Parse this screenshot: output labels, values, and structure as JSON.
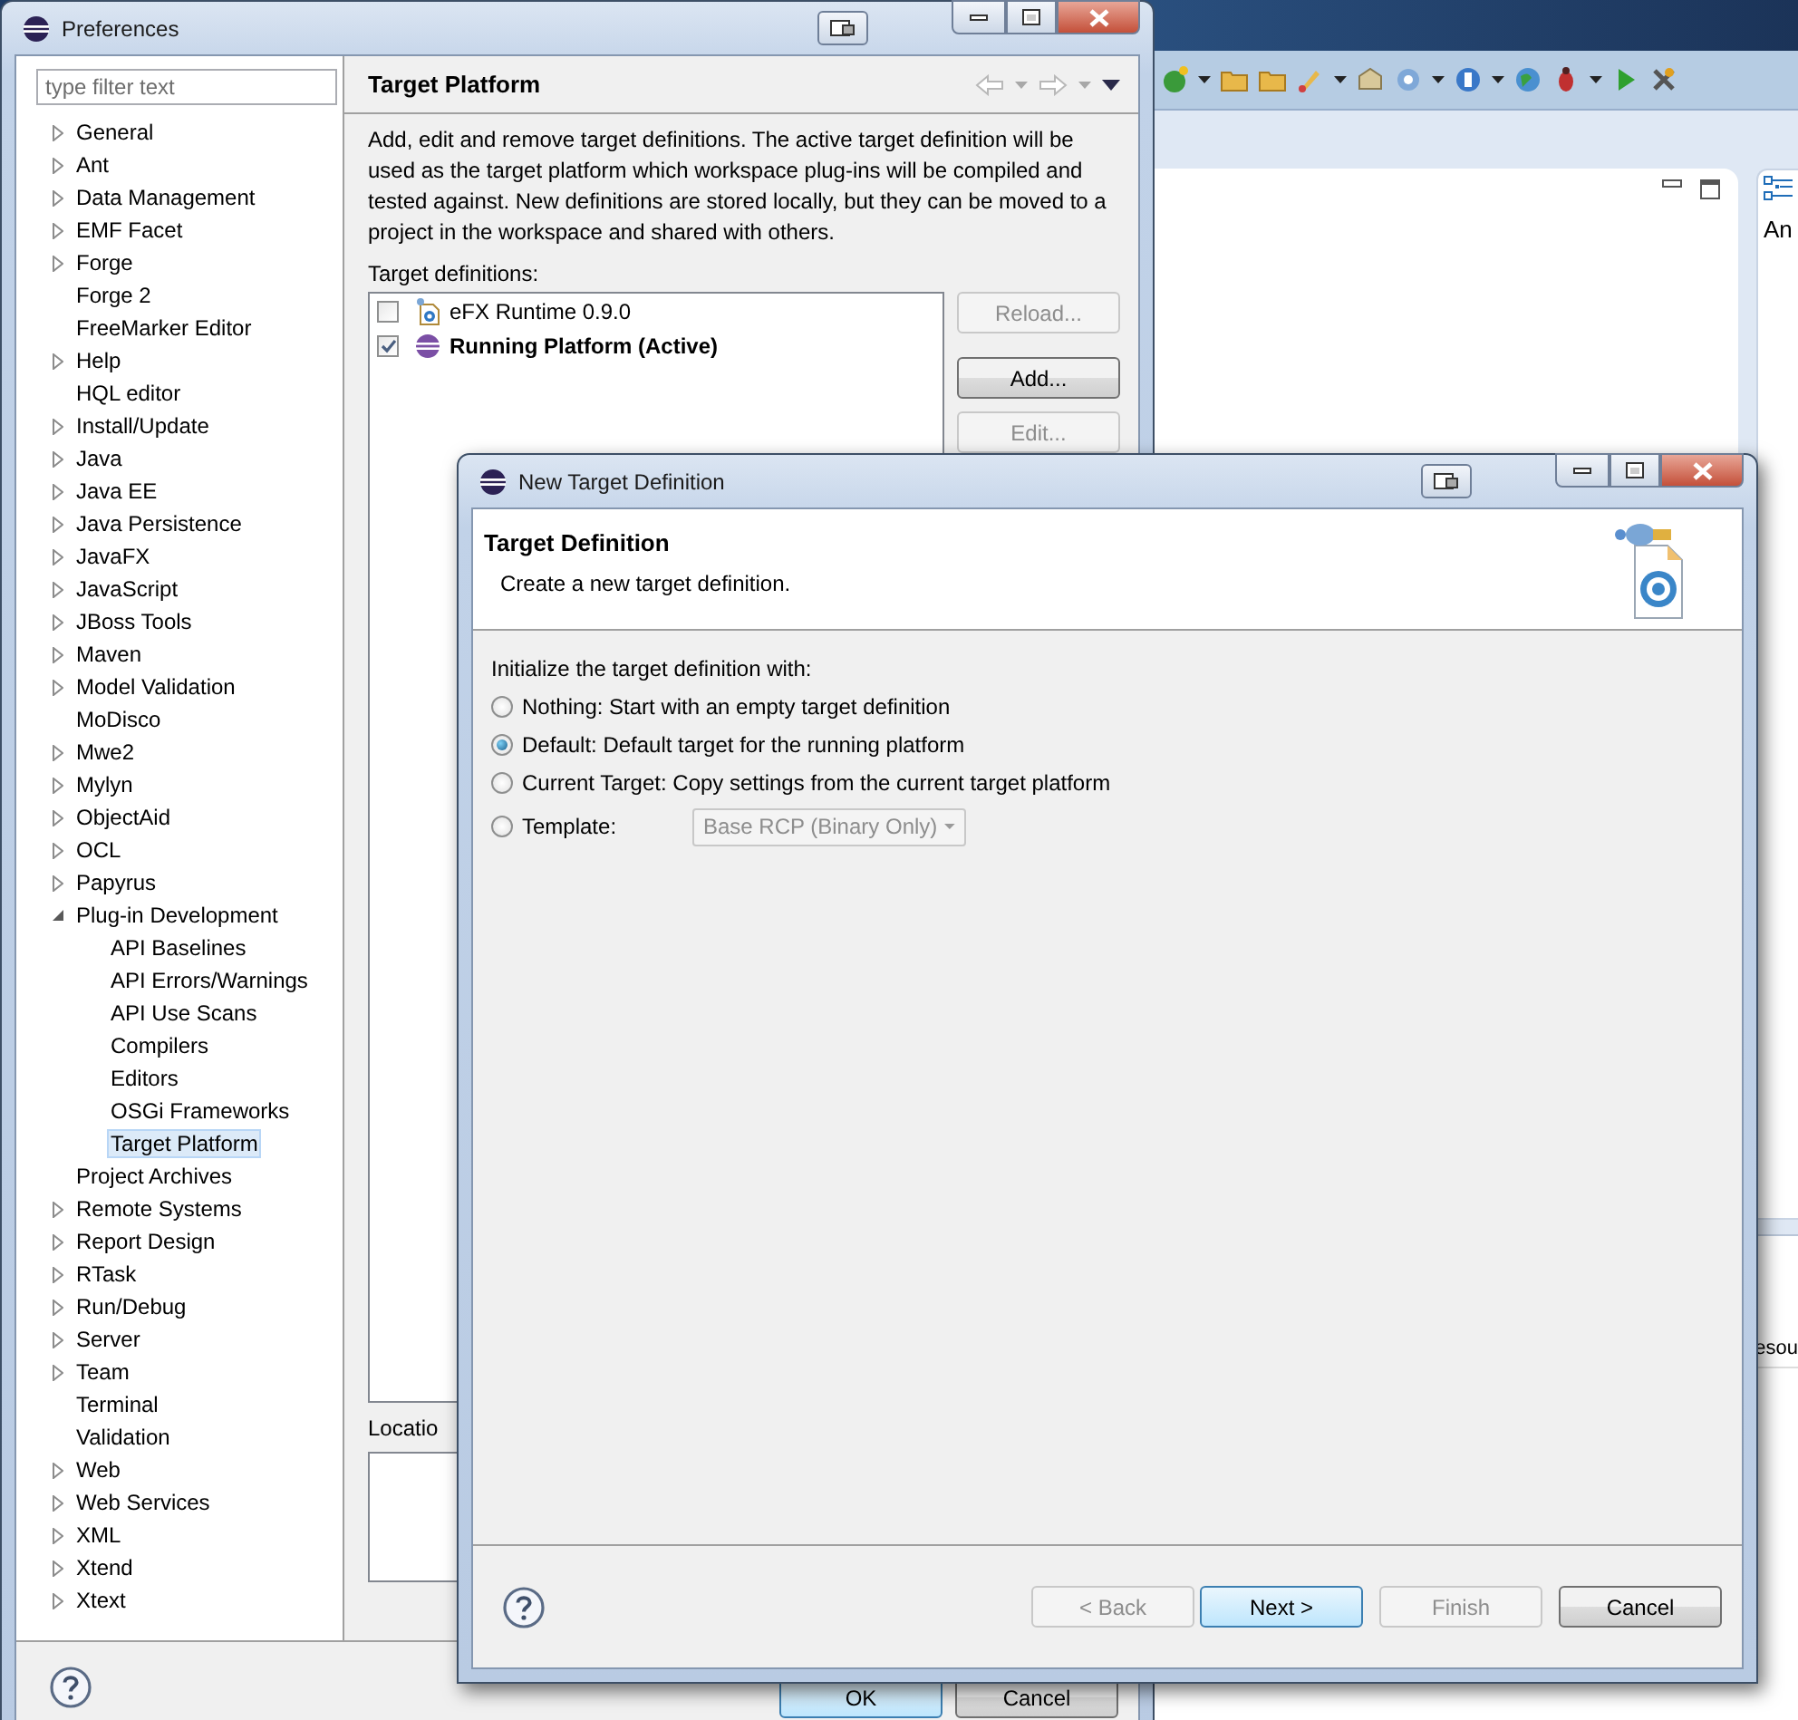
{
  "workbench": {
    "side_view_text": "An",
    "table_header_text": "esou"
  },
  "preferences": {
    "title": "Preferences",
    "filter": {
      "placeholder": "type filter text"
    },
    "tree": [
      {
        "label": "General",
        "expandable": true,
        "expanded": false,
        "selected": false
      },
      {
        "label": "Ant",
        "expandable": true,
        "expanded": false,
        "selected": false
      },
      {
        "label": "Data Management",
        "expandable": true,
        "expanded": false,
        "selected": false
      },
      {
        "label": "EMF Facet",
        "expandable": true,
        "expanded": false,
        "selected": false
      },
      {
        "label": "Forge",
        "expandable": true,
        "expanded": false,
        "selected": false
      },
      {
        "label": "Forge 2",
        "expandable": false,
        "selected": false
      },
      {
        "label": "FreeMarker Editor",
        "expandable": false,
        "selected": false
      },
      {
        "label": "Help",
        "expandable": true,
        "expanded": false,
        "selected": false
      },
      {
        "label": "HQL editor",
        "expandable": false,
        "selected": false
      },
      {
        "label": "Install/Update",
        "expandable": true,
        "expanded": false,
        "selected": false
      },
      {
        "label": "Java",
        "expandable": true,
        "expanded": false,
        "selected": false
      },
      {
        "label": "Java EE",
        "expandable": true,
        "expanded": false,
        "selected": false
      },
      {
        "label": "Java Persistence",
        "expandable": true,
        "expanded": false,
        "selected": false
      },
      {
        "label": "JavaFX",
        "expandable": true,
        "expanded": false,
        "selected": false
      },
      {
        "label": "JavaScript",
        "expandable": true,
        "expanded": false,
        "selected": false
      },
      {
        "label": "JBoss Tools",
        "expandable": true,
        "expanded": false,
        "selected": false
      },
      {
        "label": "Maven",
        "expandable": true,
        "expanded": false,
        "selected": false
      },
      {
        "label": "Model Validation",
        "expandable": true,
        "expanded": false,
        "selected": false
      },
      {
        "label": "MoDisco",
        "expandable": false,
        "selected": false
      },
      {
        "label": "Mwe2",
        "expandable": true,
        "expanded": false,
        "selected": false
      },
      {
        "label": "Mylyn",
        "expandable": true,
        "expanded": false,
        "selected": false
      },
      {
        "label": "ObjectAid",
        "expandable": true,
        "expanded": false,
        "selected": false
      },
      {
        "label": "OCL",
        "expandable": true,
        "expanded": false,
        "selected": false
      },
      {
        "label": "Papyrus",
        "expandable": true,
        "expanded": false,
        "selected": false
      },
      {
        "label": "Plug-in Development",
        "expandable": true,
        "expanded": true,
        "selected": false,
        "children": [
          {
            "label": "API Baselines",
            "selected": false
          },
          {
            "label": "API Errors/Warnings",
            "selected": false
          },
          {
            "label": "API Use Scans",
            "selected": false
          },
          {
            "label": "Compilers",
            "selected": false
          },
          {
            "label": "Editors",
            "selected": false
          },
          {
            "label": "OSGi Frameworks",
            "selected": false
          },
          {
            "label": "Target Platform",
            "selected": true
          }
        ]
      },
      {
        "label": "Project Archives",
        "expandable": false,
        "selected": false
      },
      {
        "label": "Remote Systems",
        "expandable": true,
        "expanded": false,
        "selected": false
      },
      {
        "label": "Report Design",
        "expandable": true,
        "expanded": false,
        "selected": false
      },
      {
        "label": "RTask",
        "expandable": true,
        "expanded": false,
        "selected": false
      },
      {
        "label": "Run/Debug",
        "expandable": true,
        "expanded": false,
        "selected": false
      },
      {
        "label": "Server",
        "expandable": true,
        "expanded": false,
        "selected": false
      },
      {
        "label": "Team",
        "expandable": true,
        "expanded": false,
        "selected": false
      },
      {
        "label": "Terminal",
        "expandable": false,
        "selected": false
      },
      {
        "label": "Validation",
        "expandable": false,
        "selected": false
      },
      {
        "label": "Web",
        "expandable": true,
        "expanded": false,
        "selected": false
      },
      {
        "label": "Web Services",
        "expandable": true,
        "expanded": false,
        "selected": false
      },
      {
        "label": "XML",
        "expandable": true,
        "expanded": false,
        "selected": false
      },
      {
        "label": "Xtend",
        "expandable": true,
        "expanded": false,
        "selected": false
      },
      {
        "label": "Xtext",
        "expandable": true,
        "expanded": false,
        "selected": false
      }
    ],
    "page": {
      "title": "Target Platform",
      "description": "Add, edit and remove target definitions.  The active target definition will be used as the target platform which workspace plug-ins will be compiled and tested against.  New definitions are stored locally, but they can be moved to a project in the workspace and shared with others.",
      "definitions_label": "Target definitions:",
      "definitions": [
        {
          "label": "eFX Runtime 0.9.0",
          "kind": "file",
          "checked": false,
          "active": false
        },
        {
          "label": "Running Platform (Active)",
          "kind": "running",
          "checked": true,
          "active": true
        }
      ],
      "side_buttons": [
        {
          "label": "Reload...",
          "disabled": true
        },
        {
          "label": "Add...",
          "disabled": false
        },
        {
          "label": "Edit...",
          "disabled": true
        }
      ],
      "locations_label": "Locatio"
    },
    "buttons": [
      {
        "label": "OK",
        "default": true
      },
      {
        "label": "Cancel",
        "default": false
      }
    ]
  },
  "dialog": {
    "title": "New Target Definition",
    "header_title": "Target Definition",
    "header_message": "Create a new target definition.",
    "prompt": "Initialize the target definition with:",
    "options": [
      {
        "label": "Nothing: Start with an empty target definition",
        "selected": false
      },
      {
        "label": "Default: Default target for the running platform",
        "selected": true
      },
      {
        "label": "Current Target: Copy settings from the current target platform",
        "selected": false
      },
      {
        "label": "Template:",
        "selected": false,
        "combo": {
          "value": "Base RCP (Binary Only)",
          "disabled": true
        }
      }
    ],
    "buttons": [
      {
        "label": "< Back",
        "disabled": true,
        "default": false
      },
      {
        "label": "Next >",
        "disabled": false,
        "default": true
      },
      {
        "label": "Finish",
        "disabled": true,
        "default": false
      },
      {
        "label": "Cancel",
        "disabled": false,
        "default": false
      }
    ]
  }
}
